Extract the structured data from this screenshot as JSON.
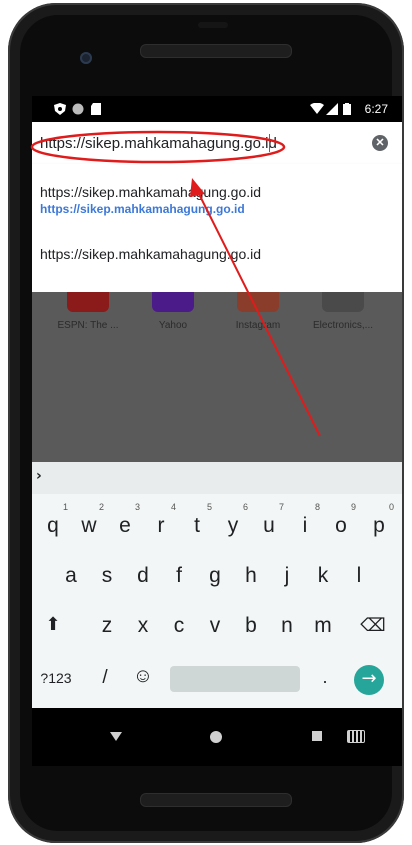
{
  "status_bar": {
    "time": "6:27"
  },
  "url_bar": {
    "value": "https://sikep.mahkamahagung.go.id",
    "clear_glyph": "✕"
  },
  "suggestions": [
    {
      "main": "https://sikep.mahkamahagung.go.id",
      "sub": "https://sikep.mahkamahagung.go.id"
    },
    {
      "main": "https://sikep.mahkamahagung.go.id"
    }
  ],
  "tiles": [
    {
      "label": "ESPN: The ...",
      "color": "#8b1a1a"
    },
    {
      "label": "Yahoo",
      "color": "#4b1b8a"
    },
    {
      "label": "Instagram",
      "color": "#8a3d2a"
    },
    {
      "label": "Electronics,...",
      "color": "#4a4a4a"
    }
  ],
  "keyboard": {
    "toolbar_chevron": "›",
    "row1": [
      {
        "k": "q",
        "n": "1"
      },
      {
        "k": "w",
        "n": "2"
      },
      {
        "k": "e",
        "n": "3"
      },
      {
        "k": "r",
        "n": "4"
      },
      {
        "k": "t",
        "n": "5"
      },
      {
        "k": "y",
        "n": "6"
      },
      {
        "k": "u",
        "n": "7"
      },
      {
        "k": "i",
        "n": "8"
      },
      {
        "k": "o",
        "n": "9"
      },
      {
        "k": "p",
        "n": "0"
      }
    ],
    "row2": [
      "a",
      "s",
      "d",
      "f",
      "g",
      "h",
      "j",
      "k",
      "l"
    ],
    "row3": [
      "z",
      "x",
      "c",
      "v",
      "b",
      "n",
      "m"
    ],
    "symbols_label": "?123",
    "slash": "/",
    "emoji": "☺",
    "period": ".",
    "enter_glyph": "→",
    "shift_glyph": "⬆",
    "backspace_glyph": "⌫"
  },
  "colors": {
    "annotation": "#e01b1b",
    "suggestion_link": "#3c78d8",
    "enter_key": "#26a69a"
  }
}
